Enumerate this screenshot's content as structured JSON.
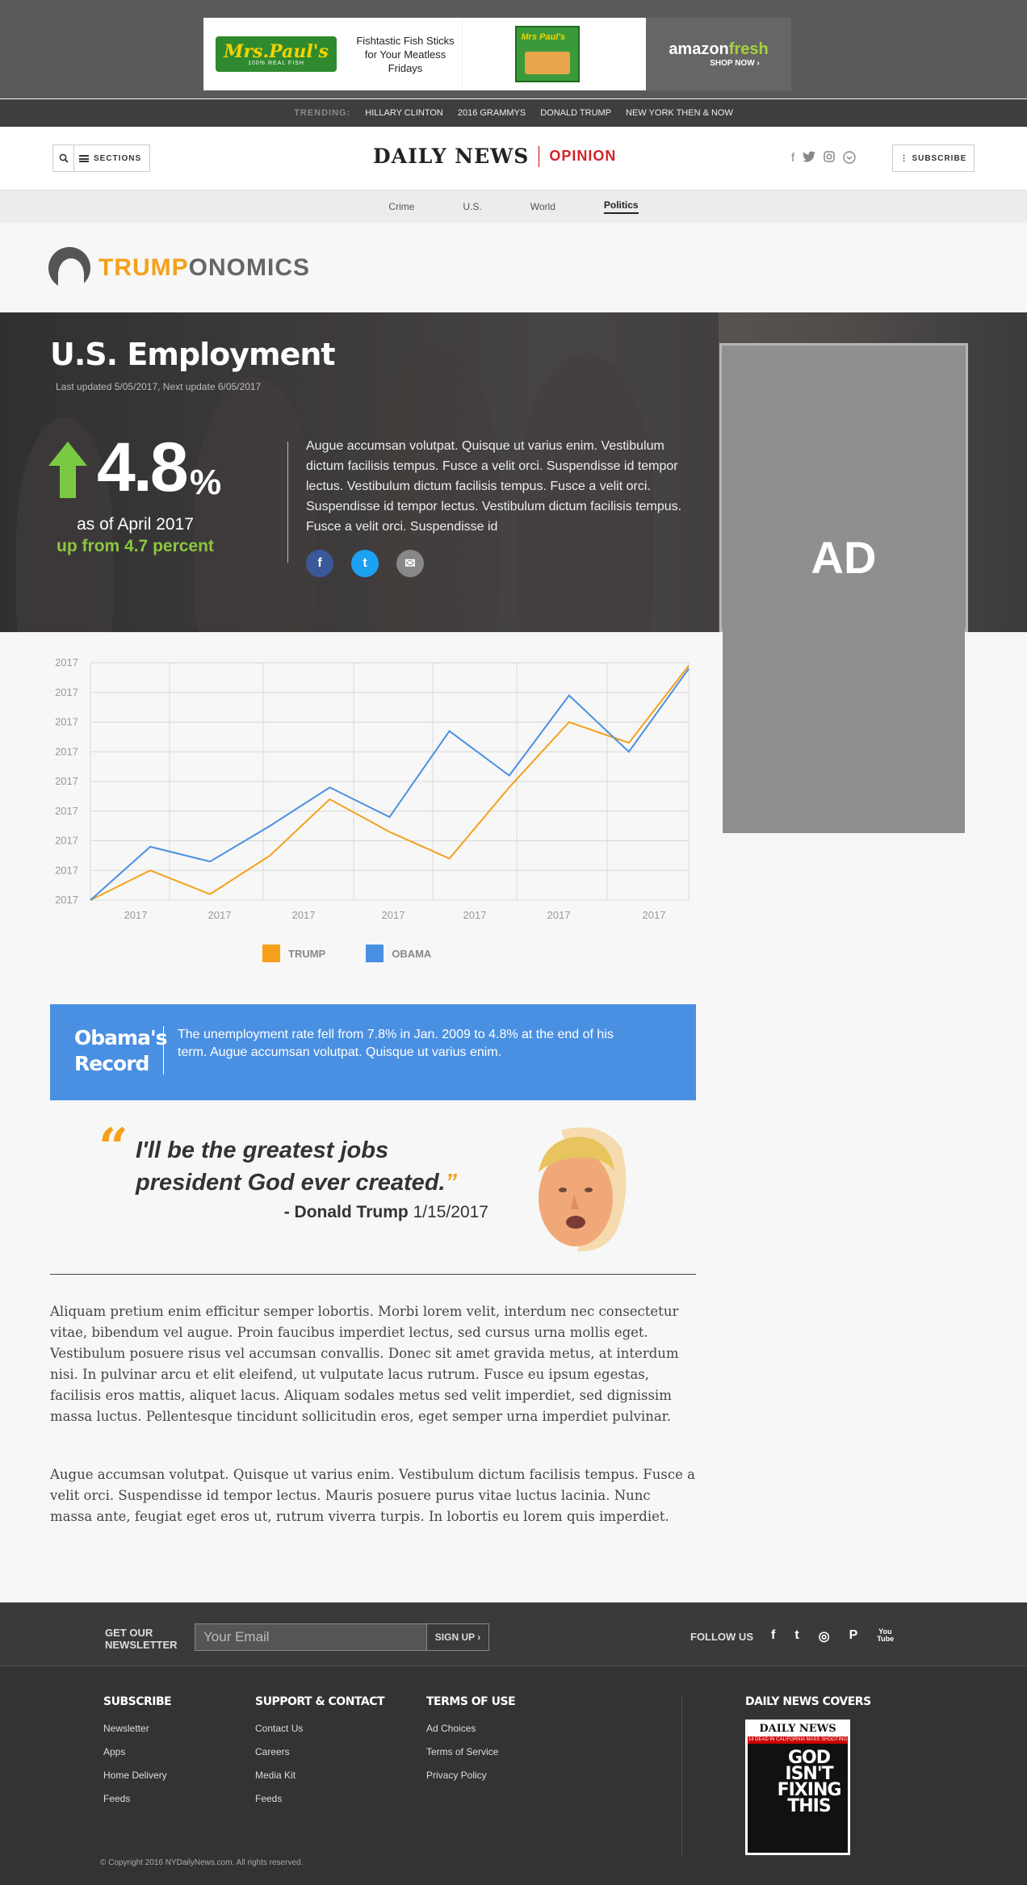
{
  "ad_banner": {
    "brand_logo": "Mrs.Paul's",
    "brand_sub": "100% REAL FISH",
    "tagline": "Fishtastic Fish Sticks for Your Meatless Fridays",
    "amazon_brand_a": "amazon",
    "amazon_brand_b": "fresh",
    "amazon_cta": "SHOP NOW ›"
  },
  "trending": {
    "label": "TRENDING:",
    "items": [
      "HILLARY CLINTON",
      "2016 GRAMMYS",
      "DONALD TRUMP",
      "NEW YORK THEN & NOW"
    ]
  },
  "header": {
    "sections_label": "SECTIONS",
    "logo_text": "DAILY NEWS",
    "section_title": "OPINION",
    "subscribe_label": "SUBSCRIBE",
    "social_icons": [
      "facebook-icon",
      "twitter-icon",
      "instagram-icon",
      "chevron-down-icon"
    ]
  },
  "nav": {
    "items": [
      "Crime",
      "U.S.",
      "World",
      "Politics"
    ],
    "active": "Politics"
  },
  "brand": {
    "part1": "TRUMP",
    "part2": "ONOMICS"
  },
  "hero": {
    "title": "U.S. Employment",
    "updated": "Last updated 5/05/2017, Next update 6/05/2017",
    "value": "4.8",
    "unit": "%",
    "as_of": "as of April 2017",
    "change": "up from 4.7 percent",
    "body": "Augue accumsan volutpat. Quisque ut varius enim. Vestibulum dictum facilisis tempus. Fusce a velit orci. Suspendisse id tempor lectus. Vestibulum dictum facilisis tempus. Fusce a velit orci. Suspendisse id tempor lectus. Vestibulum dictum facilisis tempus. Fusce a velit orci. Suspendisse id",
    "share": [
      "f",
      "t",
      "✉"
    ]
  },
  "ad_label": "AD",
  "chart_data": {
    "type": "line",
    "y_tick_labels": [
      "2017",
      "2017",
      "2017",
      "2017",
      "2017",
      "2017",
      "2017",
      "2017",
      "2017"
    ],
    "x_tick_labels": [
      "2017",
      "2017",
      "2017",
      "2017",
      "2017",
      "2017",
      "2017"
    ],
    "ylim": [
      0,
      8
    ],
    "x": [
      0,
      1,
      2,
      3,
      4,
      5,
      6,
      7,
      8,
      9,
      10
    ],
    "grid": true,
    "legend_position": "bottom-center",
    "series": [
      {
        "name": "TRUMP",
        "color": "#f5a01a",
        "values": [
          0,
          1.0,
          0.2,
          1.5,
          3.4,
          2.3,
          1.4,
          3.8,
          6.0,
          5.3,
          7.9
        ]
      },
      {
        "name": "OBAMA",
        "color": "#4a90e2",
        "values": [
          0,
          1.8,
          1.3,
          2.5,
          3.8,
          2.8,
          5.7,
          4.2,
          6.9,
          5.0,
          7.8
        ]
      }
    ]
  },
  "record": {
    "title_line1": "Obama's",
    "title_line2": "Record",
    "body": "The unemployment rate fell from 7.8% in Jan. 2009 to 4.8% at the end of his term. Augue accumsan volutpat. Quisque ut varius enim."
  },
  "quote": {
    "open_mark": "“",
    "text": "I'll be the greatest jobs president God ever created.",
    "close_mark": "”",
    "author": "- Donald Trump",
    "date": "1/15/2017"
  },
  "paragraphs": [
    "Aliquam pretium enim efficitur semper lobortis. Morbi lorem velit, interdum nec consectetur vitae, bibendum vel augue. Proin faucibus imperdiet lectus, sed cursus urna mollis eget. Vestibulum posuere risus vel accumsan convallis. Donec sit amet gravida metus, at interdum nisi. In pulvinar arcu et elit eleifend, ut vulputate lacus rutrum. Fusce eu ipsum egestas, facilisis eros mattis, aliquet lacus. Aliquam sodales metus sed velit imperdiet, sed dignissim massa luctus. Pellentesque tincidunt sollicitudin eros, eget semper urna imperdiet pulvinar.",
    "Augue accumsan volutpat. Quisque ut varius enim. Vestibulum dictum facilisis tempus. Fusce a velit orci. Suspendisse id tempor lectus. Mauris posuere purus vitae luctus lacinia. Nunc massa ante, feugiat eget eros ut, rutrum viverra turpis. In lobortis eu lorem quis imperdiet."
  ],
  "footer": {
    "newsletter_line1": "GET OUR",
    "newsletter_line2": "NEWSLETTER",
    "email_placeholder": "Your Email",
    "signup_label": "SIGN UP ›",
    "follow_label": "FOLLOW US",
    "follow_icons": [
      "f",
      "t",
      "◎",
      "P",
      "You Tube"
    ],
    "columns": [
      {
        "heading": "SUBSCRIBE",
        "links": [
          "Newsletter",
          "Apps",
          "Home Delivery",
          "Feeds"
        ]
      },
      {
        "heading": "SUPPORT & CONTACT",
        "links": [
          "Contact Us",
          "Careers",
          "Media Kit",
          "Feeds"
        ]
      },
      {
        "heading": "TERMS OF USE",
        "links": [
          "Ad Choices",
          "Terms of Service",
          "Privacy Policy"
        ]
      }
    ],
    "covers_heading": "DAILY NEWS COVERS",
    "cover_masthead": "DAILY NEWS",
    "cover_strap": "14 DEAD IN CALIFORNIA MASS SHOOTING",
    "cover_headline": "GOD ISN'T FIXING THIS",
    "copyright": "© Copyright 2016 NYDailyNews.com. All rights reserved."
  }
}
